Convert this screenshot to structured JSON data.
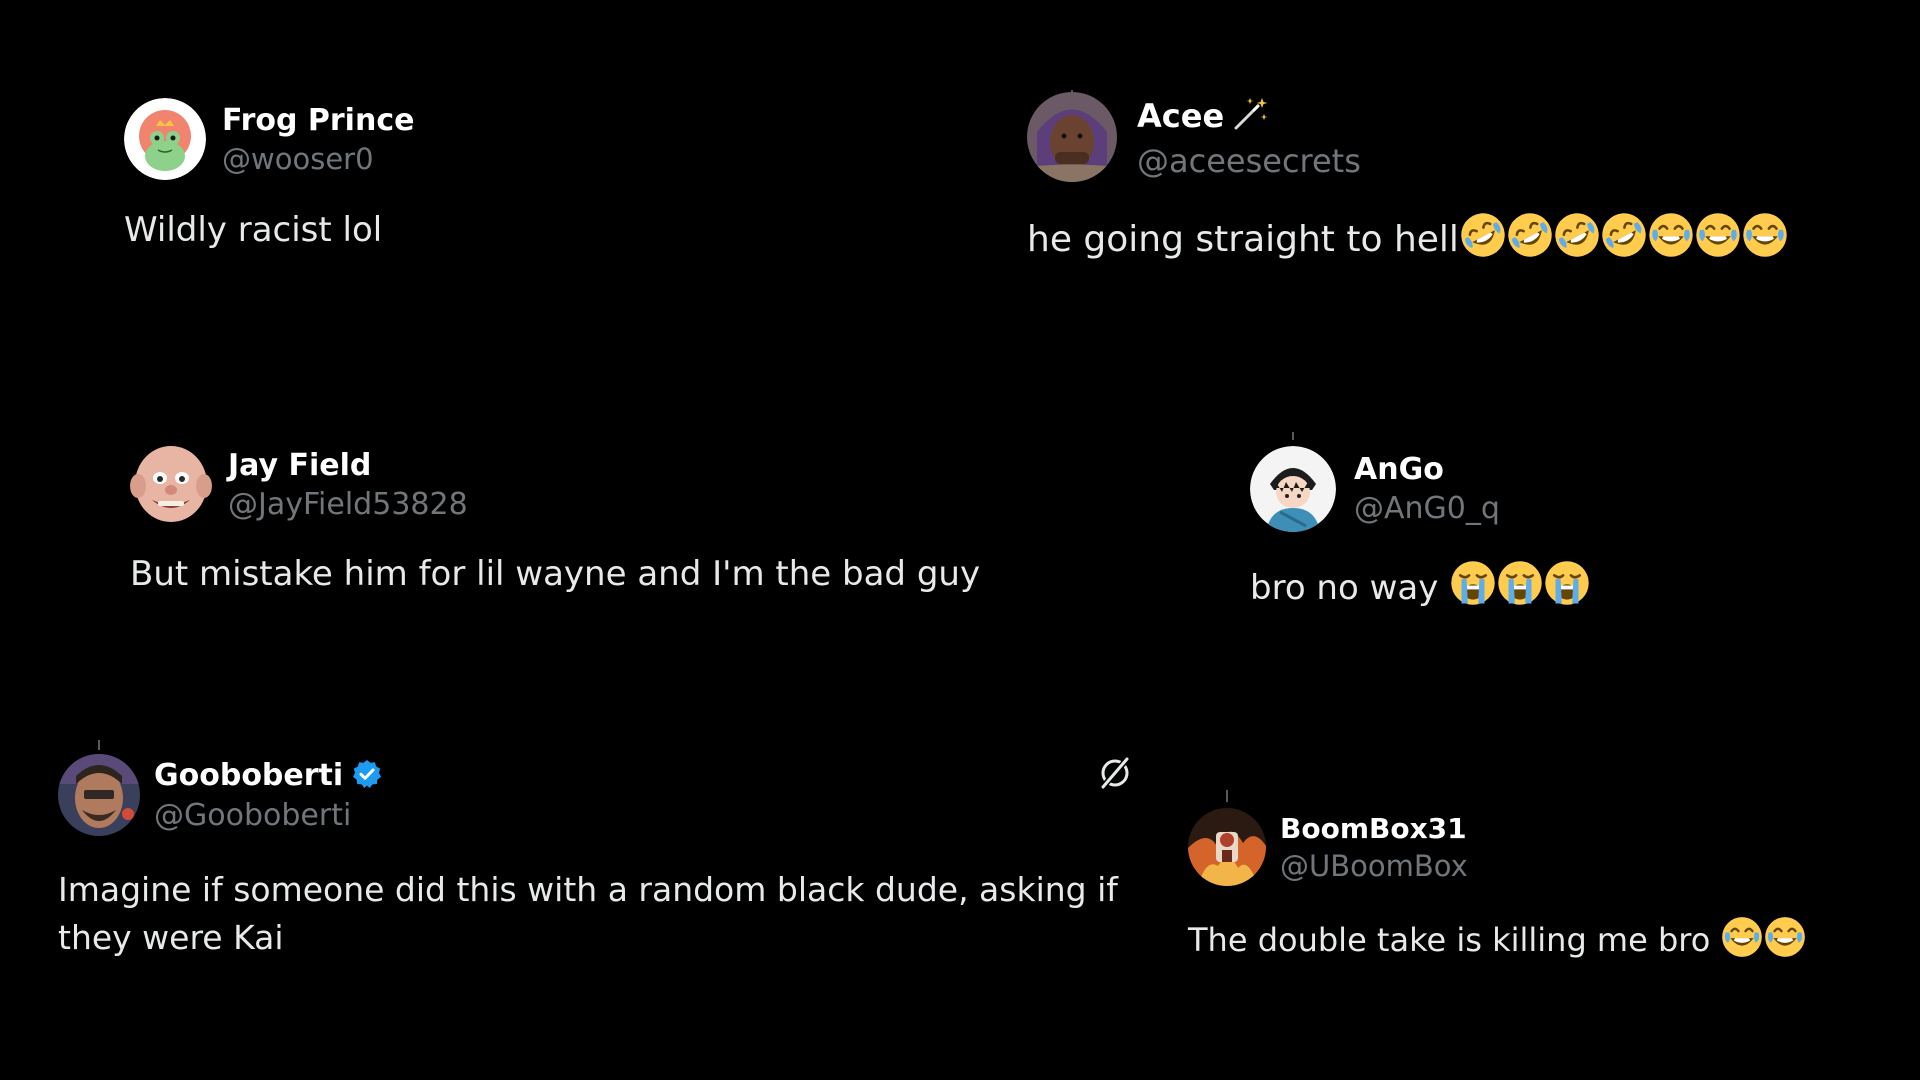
{
  "colors": {
    "background": "#000000",
    "display_name": "#ffffff",
    "handle": "#71767b",
    "text": "#e7e9ea",
    "verified_badge": "#1d9bf0"
  },
  "tweets": [
    {
      "display_name": "Frog Prince",
      "handle": "@wooser0",
      "text": "Wildly racist lol",
      "avatar_icon": "frog-avatar"
    },
    {
      "display_name": "Acee",
      "name_badge_icon": "magic-wand-icon",
      "handle": "@aceesecrets",
      "text": "he going straight to hell",
      "emojis": [
        "rofl",
        "rofl",
        "rofl",
        "rofl",
        "joy",
        "joy",
        "joy"
      ],
      "avatar_icon": "person-photo-avatar"
    },
    {
      "display_name": "Jay Field",
      "handle": "@JayField53828",
      "text": "But mistake him for lil wayne and I'm the bad guy",
      "avatar_icon": "cartoon-face-avatar"
    },
    {
      "display_name": "AnGo",
      "handle": "@AnG0_q",
      "text": "bro no way",
      "emojis": [
        "sob",
        "sob",
        "sob"
      ],
      "avatar_icon": "anime-character-avatar"
    },
    {
      "display_name": "Gooboberti",
      "verified": true,
      "handle": "@Gooboberti",
      "text": "Imagine if someone did this with a random black dude, asking if they were Kai",
      "avatar_icon": "person-photo-avatar",
      "action_icon": "grok-icon"
    },
    {
      "display_name": "BoomBox31",
      "handle": "@UBoomBox",
      "text": "The double take is killing me bro",
      "emojis": [
        "joy",
        "joy"
      ],
      "avatar_icon": "fire-photo-avatar"
    }
  ]
}
